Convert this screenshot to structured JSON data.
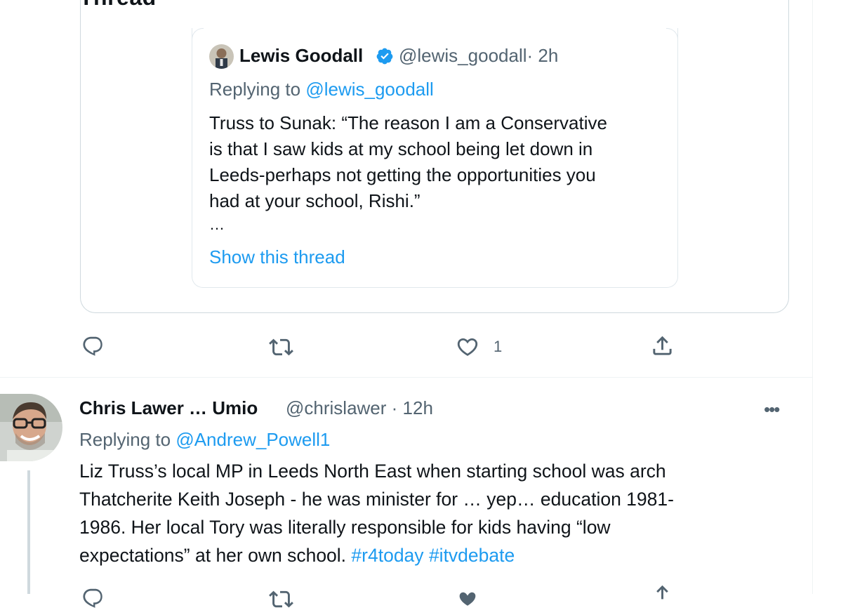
{
  "header": {
    "title": "Thread"
  },
  "quoted_tweet": {
    "author_name": "Lewis Goodall",
    "author_handle": "@lewis_goodall",
    "time": "· 2h",
    "replying_prefix": "Replying to",
    "replying_to": "@lewis_goodall",
    "body_lines": [
      "Truss to Sunak: “The reason I am a Conservative",
      "is that I saw kids at my school being let down in",
      "Leeds-perhaps not getting the opportunities you",
      "had at your school, Rishi.”"
    ],
    "truncation": "…",
    "show_thread": "Show this thread"
  },
  "actions": {
    "reply_icon": "reply-icon",
    "retweet_icon": "retweet-icon",
    "like_icon": "heart-icon",
    "like_count": "1",
    "share_icon": "share-icon"
  },
  "reply_tweet": {
    "author_name": "Chris Lawer … Umio",
    "author_handle": "@chrislawer · 12h",
    "more_label": "•••",
    "replying_prefix": "Replying to",
    "replying_to": "@Andrew_Powell1",
    "body_lines": [
      "Liz Truss’s local MP in Leeds North East when starting school was arch",
      "Thatcherite Keith Joseph - he was minister for … yep… education 1981-",
      "1986. Her local Tory was literally responsible for kids having “low",
      "expectations” at her own school."
    ],
    "hashtags": [
      "#r4today",
      "#itvdebate"
    ]
  },
  "colors": {
    "link": "#1d9bf0",
    "secondary_text": "#536471",
    "border": "#cfd9de",
    "verified": "#1d9bf0"
  }
}
